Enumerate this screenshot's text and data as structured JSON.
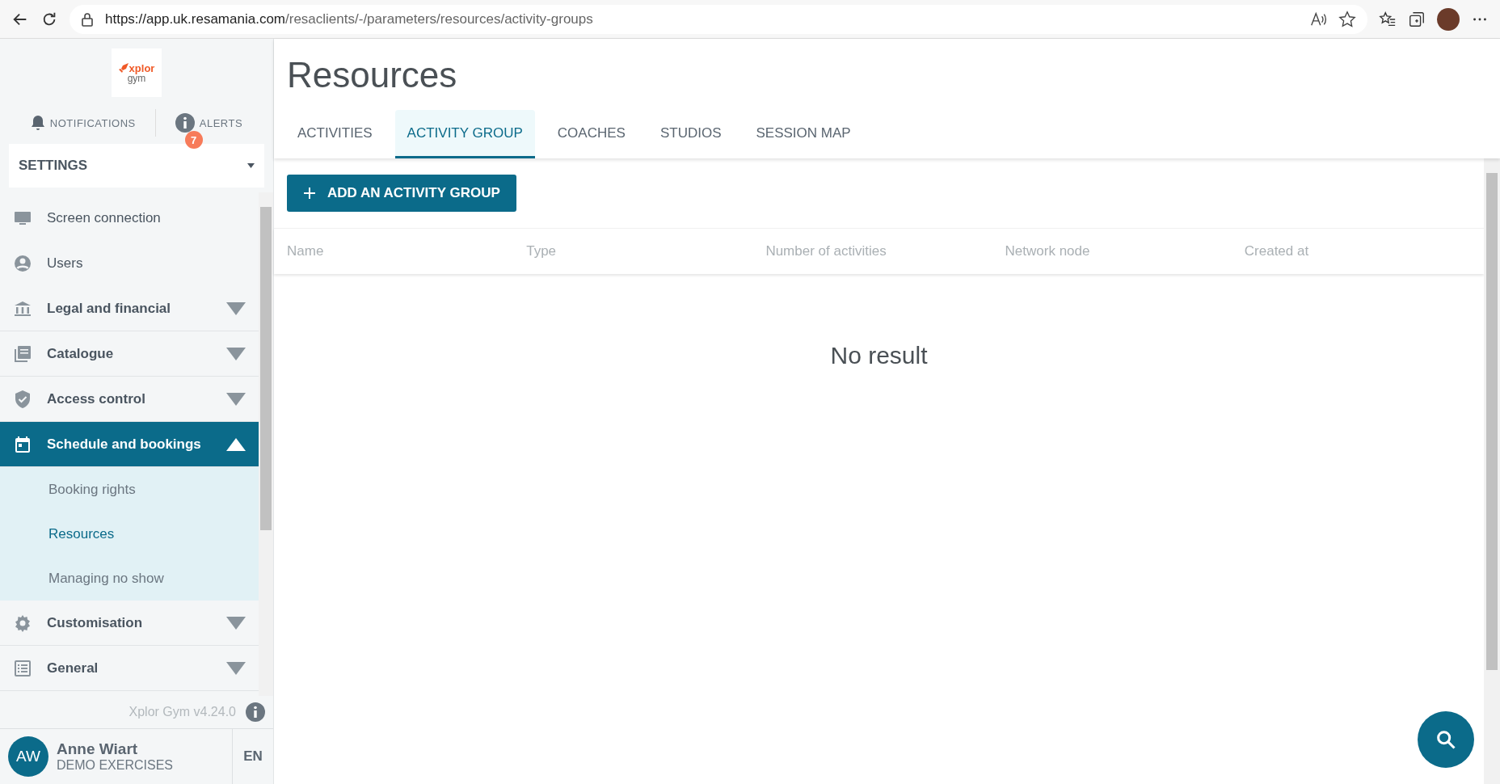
{
  "browser": {
    "url_host": "https://app.uk.resamania.com",
    "url_path": "/resaclients/-/parameters/resources/activity-groups"
  },
  "sidebar": {
    "logo": {
      "brand": "xplor",
      "sub": "gym"
    },
    "notifications": "NOTIFICATIONS",
    "alerts": {
      "label": "ALERTS",
      "badge": "7"
    },
    "section": "SETTINGS",
    "items": [
      {
        "label": "Screen connection",
        "kind": "link",
        "selected": false
      },
      {
        "label": "Users",
        "kind": "link",
        "selected": false
      },
      {
        "label": "Legal and financial",
        "kind": "group",
        "expanded": false,
        "selected": false
      },
      {
        "label": "Catalogue",
        "kind": "group",
        "expanded": false,
        "selected": false
      },
      {
        "label": "Access control",
        "kind": "group",
        "expanded": false,
        "selected": false
      },
      {
        "label": "Schedule and bookings",
        "kind": "group",
        "expanded": true,
        "selected": true,
        "children": [
          {
            "label": "Booking rights",
            "selected": false
          },
          {
            "label": "Resources",
            "selected": true
          },
          {
            "label": "Managing no show",
            "selected": false
          }
        ]
      },
      {
        "label": "Customisation",
        "kind": "group",
        "expanded": false,
        "selected": false
      },
      {
        "label": "General",
        "kind": "group",
        "expanded": false,
        "selected": false
      }
    ],
    "version": "Xplor Gym v4.24.0",
    "user": {
      "initials": "AW",
      "name": "Anne Wiart",
      "org": "DEMO EXERCISES"
    },
    "language": "EN"
  },
  "main": {
    "title": "Resources",
    "tabs": [
      {
        "label": "ACTIVITIES",
        "selected": false
      },
      {
        "label": "ACTIVITY GROUP",
        "selected": true
      },
      {
        "label": "COACHES",
        "selected": false
      },
      {
        "label": "STUDIOS",
        "selected": false
      },
      {
        "label": "SESSION MAP",
        "selected": false
      }
    ],
    "add_button": "ADD AN ACTIVITY GROUP",
    "table": {
      "columns": [
        "Name",
        "Type",
        "Number of activities",
        "Network node",
        "Created at"
      ],
      "empty_message": "No result"
    }
  }
}
